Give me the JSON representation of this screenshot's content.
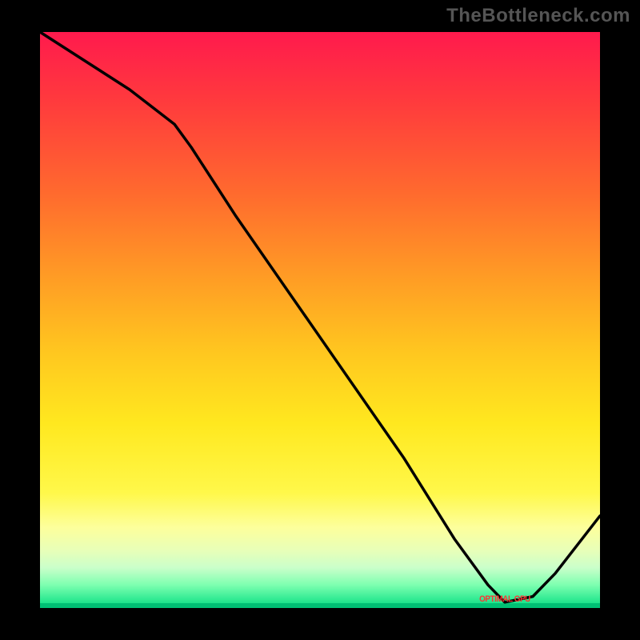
{
  "attribution": "TheBottleneck.com",
  "chart_data": {
    "type": "line",
    "title": "",
    "xlabel": "",
    "ylabel": "",
    "xlim": [
      0,
      100
    ],
    "ylim": [
      0,
      100
    ],
    "background_gradient": {
      "top_color": "#ff1a4d",
      "mid_color": "#ffe81f",
      "bottom_color": "#00d07a",
      "semantics": "red=high bottleneck, green=optimal"
    },
    "series": [
      {
        "name": "bottleneck-curve",
        "x": [
          0,
          8,
          16,
          24,
          27,
          35,
          45,
          55,
          65,
          74,
          80,
          83,
          88,
          92,
          96,
          100
        ],
        "values": [
          100,
          95,
          90,
          84,
          80,
          68,
          54,
          40,
          26,
          12,
          4,
          1,
          2,
          6,
          11,
          16
        ]
      }
    ],
    "optimal_marker": {
      "label": "OPTIMAL GPU",
      "x": 83,
      "y": 1
    },
    "grid": false,
    "legend": false
  },
  "colors": {
    "frame": "#000000",
    "curve": "#000000",
    "attribution_text": "#555555",
    "marker_text": "#ff3333"
  }
}
